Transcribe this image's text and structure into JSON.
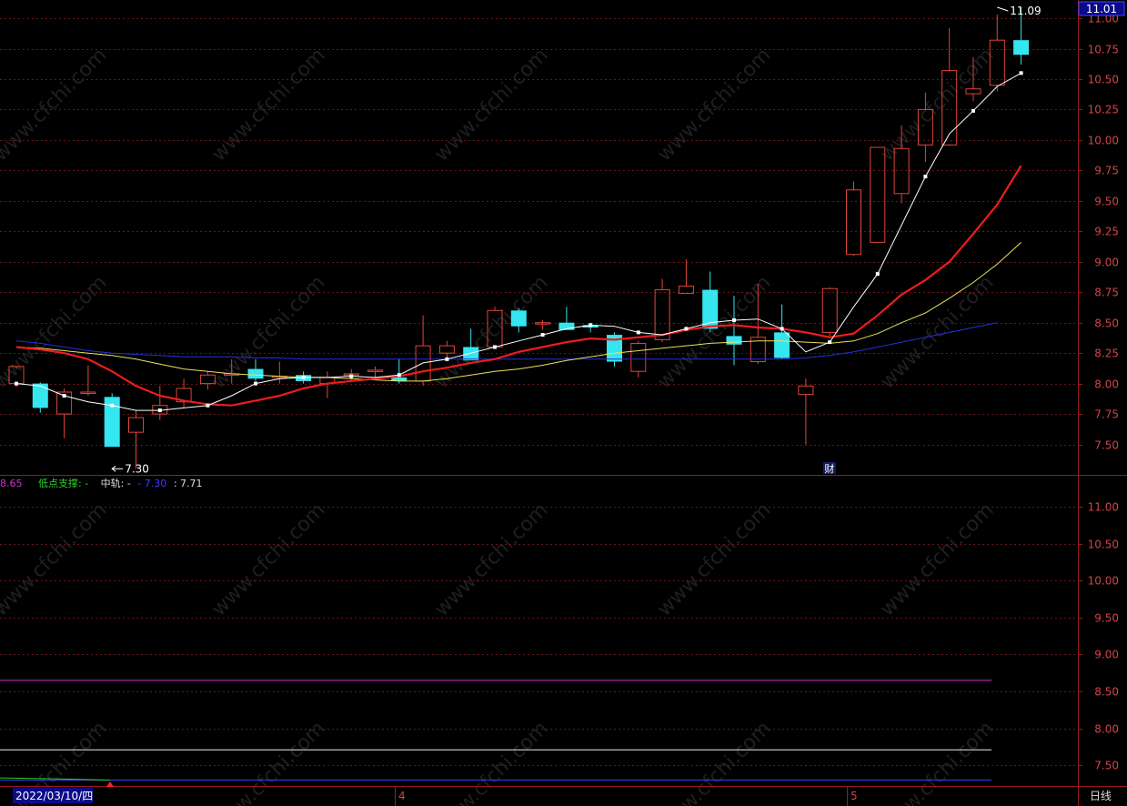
{
  "colors": {
    "background": "#000000",
    "up": "#e0453a",
    "down": "#35e6f0",
    "ma5": "#ffffff",
    "ma10": "#ee1c1c",
    "ma20": "#e8e35a",
    "ma60": "#2530d8",
    "axis": "#9a1a1a",
    "grid": "#6a1515",
    "tick_text": "#d04545",
    "magenta": "#cc33cc",
    "green": "#33cc33",
    "blue_line": "#3a3aff"
  },
  "watermark": "www.cfchi.com",
  "chart_data": [
    {
      "type": "candlestick",
      "title": "",
      "y_ticks": [
        "11.00",
        "10.75",
        "10.50",
        "10.25",
        "10.00",
        "9.75",
        "9.50",
        "9.25",
        "9.00",
        "8.75",
        "8.50",
        "8.25",
        "8.00",
        "7.75",
        "7.50"
      ],
      "ylim": [
        7.25,
        11.15
      ],
      "current_price_label": "11.01",
      "max_marker": {
        "label": "11.09",
        "value": 11.09,
        "index": 41
      },
      "min_marker": {
        "label": "7.30",
        "value": 7.3,
        "index": 4
      },
      "event_marker": {
        "label": "财",
        "index": 33
      },
      "candles": [
        {
          "o": 8.0,
          "h": 8.12,
          "l": 7.97,
          "c": 8.14
        },
        {
          "o": 8.0,
          "h": 8.01,
          "l": 7.76,
          "c": 7.8
        },
        {
          "o": 7.75,
          "h": 7.96,
          "l": 7.55,
          "c": 7.93
        },
        {
          "o": 7.93,
          "h": 8.15,
          "l": 7.9,
          "c": 7.93
        },
        {
          "o": 7.89,
          "h": 7.92,
          "l": 7.48,
          "c": 7.48
        },
        {
          "o": 7.6,
          "h": 7.78,
          "l": 7.3,
          "c": 7.72
        },
        {
          "o": 7.75,
          "h": 7.98,
          "l": 7.7,
          "c": 7.82
        },
        {
          "o": 7.85,
          "h": 8.04,
          "l": 7.8,
          "c": 7.96
        },
        {
          "o": 8.0,
          "h": 8.1,
          "l": 7.95,
          "c": 8.07
        },
        {
          "o": 8.08,
          "h": 8.2,
          "l": 8.0,
          "c": 8.08
        },
        {
          "o": 8.12,
          "h": 8.2,
          "l": 8.02,
          "c": 8.04
        },
        {
          "o": 8.06,
          "h": 8.18,
          "l": 8.0,
          "c": 8.06
        },
        {
          "o": 8.07,
          "h": 8.1,
          "l": 8.0,
          "c": 8.02
        },
        {
          "o": 8.0,
          "h": 8.1,
          "l": 7.88,
          "c": 8.05
        },
        {
          "o": 8.08,
          "h": 8.12,
          "l": 8.02,
          "c": 8.08
        },
        {
          "o": 8.11,
          "h": 8.14,
          "l": 8.05,
          "c": 8.11
        },
        {
          "o": 8.05,
          "h": 8.2,
          "l": 8.0,
          "c": 8.02
        },
        {
          "o": 8.02,
          "h": 8.56,
          "l": 7.98,
          "c": 8.31
        },
        {
          "o": 8.25,
          "h": 8.35,
          "l": 8.2,
          "c": 8.31
        },
        {
          "o": 8.3,
          "h": 8.45,
          "l": 8.2,
          "c": 8.19
        },
        {
          "o": 8.3,
          "h": 8.63,
          "l": 8.28,
          "c": 8.6
        },
        {
          "o": 8.6,
          "h": 8.62,
          "l": 8.42,
          "c": 8.47
        },
        {
          "o": 8.5,
          "h": 8.52,
          "l": 8.44,
          "c": 8.5
        },
        {
          "o": 8.5,
          "h": 8.63,
          "l": 8.44,
          "c": 8.44
        },
        {
          "o": 8.48,
          "h": 8.5,
          "l": 8.42,
          "c": 8.46
        },
        {
          "o": 8.4,
          "h": 8.42,
          "l": 8.14,
          "c": 8.18
        },
        {
          "o": 8.1,
          "h": 8.35,
          "l": 8.05,
          "c": 8.33
        },
        {
          "o": 8.36,
          "h": 8.86,
          "l": 8.34,
          "c": 8.77
        },
        {
          "o": 8.74,
          "h": 9.02,
          "l": 8.74,
          "c": 8.8
        },
        {
          "o": 8.77,
          "h": 8.92,
          "l": 8.42,
          "c": 8.45
        },
        {
          "o": 8.39,
          "h": 8.72,
          "l": 8.15,
          "c": 8.32
        },
        {
          "o": 8.18,
          "h": 8.82,
          "l": 8.16,
          "c": 8.38
        },
        {
          "o": 8.42,
          "h": 8.65,
          "l": 8.2,
          "c": 8.21
        },
        {
          "o": 7.91,
          "h": 8.04,
          "l": 7.5,
          "c": 7.98
        },
        {
          "o": 8.42,
          "h": 8.79,
          "l": 8.39,
          "c": 8.78
        },
        {
          "o": 9.06,
          "h": 9.66,
          "l": 9.05,
          "c": 9.59
        },
        {
          "o": 9.16,
          "h": 9.94,
          "l": 9.16,
          "c": 9.94
        },
        {
          "o": 9.56,
          "h": 10.12,
          "l": 9.48,
          "c": 9.93
        },
        {
          "o": 9.96,
          "h": 10.39,
          "l": 9.82,
          "c": 10.25
        },
        {
          "o": 9.96,
          "h": 10.92,
          "l": 9.95,
          "c": 10.57
        },
        {
          "o": 10.38,
          "h": 10.68,
          "l": 10.32,
          "c": 10.42
        },
        {
          "o": 10.45,
          "h": 11.03,
          "l": 10.4,
          "c": 10.82
        },
        {
          "o": 10.82,
          "h": 11.09,
          "l": 10.62,
          "c": 10.7
        }
      ],
      "ma5": [
        8.0,
        7.98,
        7.9,
        7.85,
        7.82,
        7.78,
        7.78,
        7.8,
        7.82,
        7.9,
        8.0,
        8.04,
        8.05,
        8.05,
        8.06,
        8.05,
        8.07,
        8.17,
        8.2,
        8.25,
        8.3,
        8.35,
        8.4,
        8.45,
        8.48,
        8.47,
        8.42,
        8.4,
        8.45,
        8.5,
        8.52,
        8.53,
        8.45,
        8.26,
        8.34,
        8.63,
        8.9,
        9.3,
        9.7,
        10.05,
        10.24,
        10.44,
        10.55
      ],
      "ma10": [
        8.3,
        8.28,
        8.25,
        8.2,
        8.1,
        7.98,
        7.9,
        7.86,
        7.83,
        7.82,
        7.86,
        7.9,
        7.96,
        8.0,
        8.02,
        8.04,
        8.06,
        8.1,
        8.13,
        8.17,
        8.2,
        8.26,
        8.3,
        8.34,
        8.37,
        8.36,
        8.38,
        8.4,
        8.44,
        8.47,
        8.48,
        8.46,
        8.45,
        8.42,
        8.38,
        8.41,
        8.56,
        8.73,
        8.85,
        9.0,
        9.23,
        9.47,
        9.79
      ],
      "ma20": [
        8.3,
        8.29,
        8.27,
        8.25,
        8.23,
        8.2,
        8.16,
        8.12,
        8.1,
        8.08,
        8.07,
        8.06,
        8.05,
        8.05,
        8.04,
        8.03,
        8.02,
        8.02,
        8.04,
        8.07,
        8.1,
        8.12,
        8.15,
        8.19,
        8.22,
        8.25,
        8.27,
        8.29,
        8.31,
        8.33,
        8.34,
        8.35,
        8.35,
        8.34,
        8.33,
        8.35,
        8.41,
        8.5,
        8.58,
        8.7,
        8.83,
        8.98,
        9.16
      ],
      "ma60": [
        8.35,
        8.33,
        8.3,
        8.27,
        8.25,
        8.24,
        8.23,
        8.22,
        8.22,
        8.22,
        8.21,
        8.21,
        8.2,
        8.2,
        8.2,
        8.2,
        8.2,
        8.2,
        8.2,
        8.2,
        8.2,
        8.2,
        8.2,
        8.2,
        8.2,
        8.2,
        8.2,
        8.2,
        8.2,
        8.2,
        8.2,
        8.2,
        8.2,
        8.21,
        8.23,
        8.26,
        8.3,
        8.34,
        8.38,
        8.42,
        8.46,
        8.5
      ]
    },
    {
      "type": "line",
      "title": "",
      "legend": [
        {
          "text": "8.65",
          "color": "#cc33cc"
        },
        {
          "text": "低点支撑: -",
          "color": "#33cc33"
        },
        {
          "text": "中轨: -",
          "color": "#dddddd"
        },
        {
          "text": "- 7.30",
          "color": "#3a3aff"
        },
        {
          "text": ": 7.71",
          "color": "#dddddd"
        }
      ],
      "y_ticks": [
        "11.00",
        "10.50",
        "10.00",
        "9.50",
        "9.00",
        "8.50",
        "8.00",
        "7.50"
      ],
      "ylim": [
        7.22,
        11.42
      ],
      "series": [
        {
          "color": "#cc33cc",
          "values": [
            8.65,
            8.65
          ]
        },
        {
          "color": "#eeeeee",
          "values": [
            7.71,
            7.71
          ]
        },
        {
          "color": "#3a3aff",
          "values": [
            7.3,
            7.3
          ]
        },
        {
          "color": "#33cc33",
          "values": [
            7.33,
            7.3
          ]
        }
      ]
    }
  ],
  "footer": {
    "date_label": "2022/03/10/四",
    "month_4": "4",
    "month_5": "5",
    "period_label": "日线"
  }
}
